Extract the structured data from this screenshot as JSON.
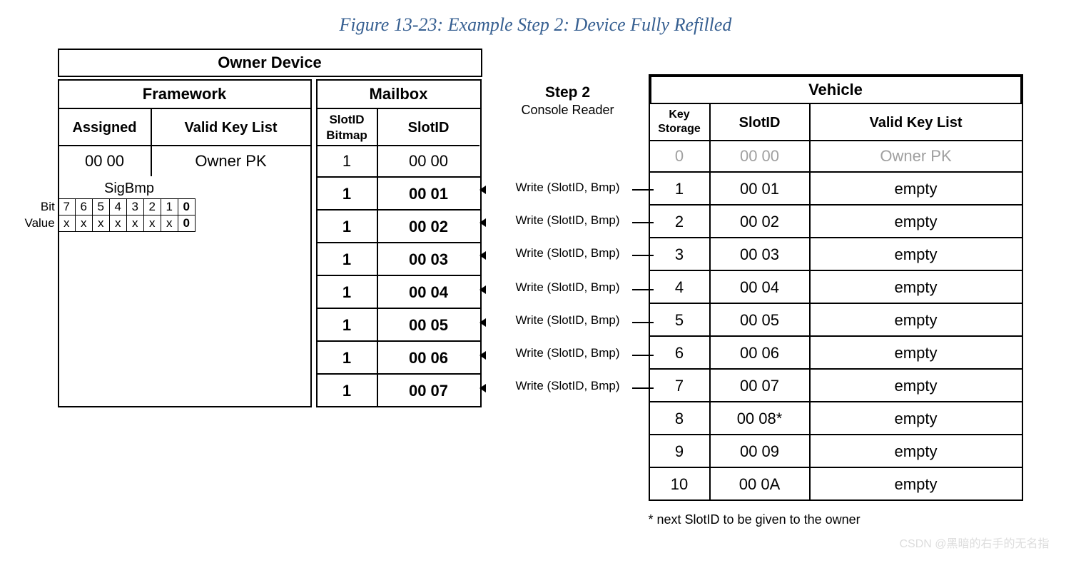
{
  "caption": "Figure 13-23: Example Step 2: Device Fully Refilled",
  "owner_device": {
    "title": "Owner Device",
    "framework": {
      "title": "Framework",
      "headers": {
        "assigned": "Assigned",
        "valid_key_list": "Valid Key List"
      },
      "rows": [
        {
          "assigned": "00 00",
          "key": "Owner PK"
        }
      ]
    },
    "mailbox": {
      "title": "Mailbox",
      "headers": {
        "bitmap": "SlotID Bitmap",
        "slotid": "SlotID"
      },
      "rows": [
        {
          "bitmap": "1",
          "slotid": "00 00",
          "bold": false
        },
        {
          "bitmap": "1",
          "slotid": "00 01",
          "bold": true
        },
        {
          "bitmap": "1",
          "slotid": "00 02",
          "bold": true
        },
        {
          "bitmap": "1",
          "slotid": "00 03",
          "bold": true
        },
        {
          "bitmap": "1",
          "slotid": "00 04",
          "bold": true
        },
        {
          "bitmap": "1",
          "slotid": "00 05",
          "bold": true
        },
        {
          "bitmap": "1",
          "slotid": "00 06",
          "bold": true
        },
        {
          "bitmap": "1",
          "slotid": "00 07",
          "bold": true
        }
      ]
    },
    "sigbmp": {
      "title": "SigBmp",
      "bit_label": "Bit",
      "value_label": "Value",
      "bits": [
        "7",
        "6",
        "5",
        "4",
        "3",
        "2",
        "1",
        "0"
      ],
      "values": [
        "x",
        "x",
        "x",
        "x",
        "x",
        "x",
        "x",
        "0"
      ]
    }
  },
  "center": {
    "step_title": "Step 2",
    "step_sub": "Console Reader",
    "write_label": "Write (SlotID, Bmp)",
    "write_tops": [
      135,
      181,
      227,
      275,
      321,
      367,
      413
    ]
  },
  "vehicle": {
    "title": "Vehicle",
    "headers": {
      "key_storage": "Key Storage",
      "slotid": "SlotID",
      "valid_key_list": "Valid Key List"
    },
    "rows": [
      {
        "storage": "0",
        "slotid": "00 00",
        "key": "Owner PK",
        "gray": true
      },
      {
        "storage": "1",
        "slotid": "00 01",
        "key": "empty"
      },
      {
        "storage": "2",
        "slotid": "00 02",
        "key": "empty"
      },
      {
        "storage": "3",
        "slotid": "00 03",
        "key": "empty"
      },
      {
        "storage": "4",
        "slotid": "00 04",
        "key": "empty"
      },
      {
        "storage": "5",
        "slotid": "00 05",
        "key": "empty"
      },
      {
        "storage": "6",
        "slotid": "00 06",
        "key": "empty"
      },
      {
        "storage": "7",
        "slotid": "00 07",
        "key": "empty"
      },
      {
        "storage": "8",
        "slotid": "00 08*",
        "key": "empty"
      },
      {
        "storage": "9",
        "slotid": "00 09",
        "key": "empty"
      },
      {
        "storage": "10",
        "slotid": "00 0A",
        "key": "empty"
      }
    ]
  },
  "footnote": "* next SlotID to be given to the owner",
  "watermark": "CSDN @黑暗的右手的无名指"
}
